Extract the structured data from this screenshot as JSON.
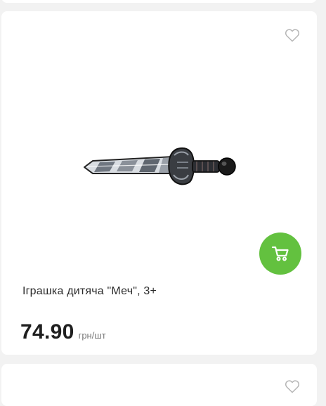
{
  "product": {
    "title": "Іграшка дитяча \"Меч\", 3+",
    "price": "74.90",
    "unit": "грн/шт",
    "image_icon": "toy-sword-image",
    "favorite_icon": "heart-outline-icon",
    "cart_icon": "shopping-cart-icon"
  },
  "colors": {
    "accent": "#63c13f",
    "background": "#f2f2f2",
    "card": "#ffffff"
  }
}
